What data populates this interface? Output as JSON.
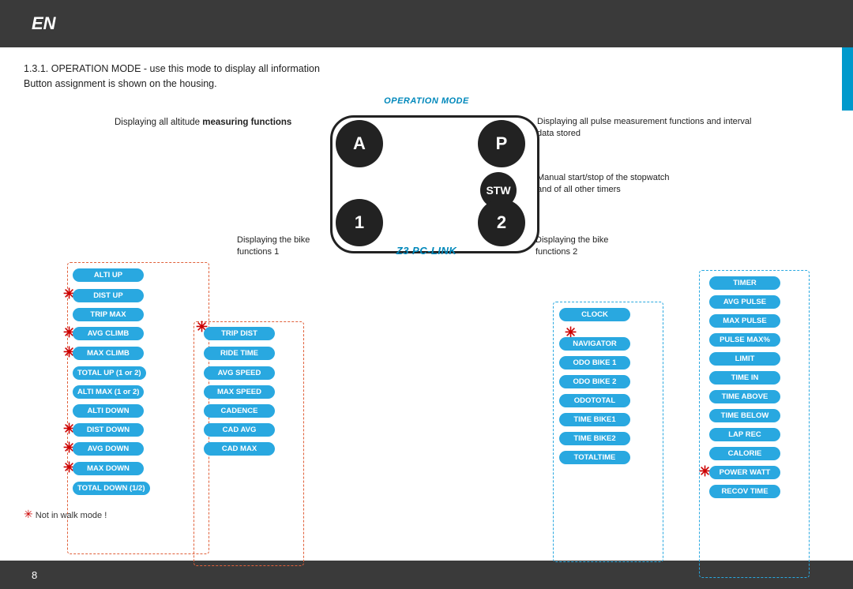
{
  "top_bar": {
    "title": "EN"
  },
  "bottom_bar": {
    "page_number": "8"
  },
  "section": {
    "title_normal": "1.3.1. OPERATION MODE - use this mode to display all information",
    "title_bold": "",
    "subtitle": "Button assignment is shown on the housing."
  },
  "op_mode_label": "OPERATION MODE",
  "z3_label": "Z3 PC-LINK",
  "circles": {
    "A": "A",
    "P": "P",
    "STW": "STW",
    "one": "1",
    "two": "2"
  },
  "descriptions": {
    "left_altitude": "Displaying all altitude measuring functions",
    "right_pulse": "Displaying all pulse measurement functions and interval data stored",
    "stw": "Manual start/stop of the stopwatch\nand of all other timers",
    "bottom_left": "Displaying the bike\nfunctions 1",
    "bottom_right": "Displaying the bike\nfunctions 2"
  },
  "left_column": [
    "ALTI UP",
    "DIST UP",
    "TRIP MAX",
    "AVG CLIMB",
    "MAX CLIMB",
    "TOTAL UP (1 or 2)",
    "ALTI MAX (1 or 2)",
    "ALTI DOWN",
    "DIST DOWN",
    "AVG DOWN",
    "MAX DOWN",
    "TOTAL DOWN (1/2)"
  ],
  "left_stars": [
    1,
    3,
    4,
    8,
    9,
    10
  ],
  "center_left_column": [
    "TRIP DIST",
    "RIDE TIME",
    "AVG SPEED",
    "MAX SPEED",
    "CADENCE",
    "CAD AVG",
    "CAD MAX"
  ],
  "center_right_column": [
    "CLOCK",
    "NAVIGATOR",
    "ODO BIKE 1",
    "ODO BIKE 2",
    "ODOTOTAL",
    "TIME BIKE1",
    "TIME BIKE2",
    "TOTALTIME"
  ],
  "right_column": [
    "TIMER",
    "AVG PULSE",
    "MAX PULSE",
    "PULSE MAX%",
    "LIMIT",
    "TIME IN",
    "TIME ABOVE",
    "TIME BELOW",
    "LAP REC",
    "CALORIE",
    "POWER WATT",
    "RECOV TIME"
  ],
  "right_stars": [
    10
  ],
  "footnote": "Not in walk mode !"
}
